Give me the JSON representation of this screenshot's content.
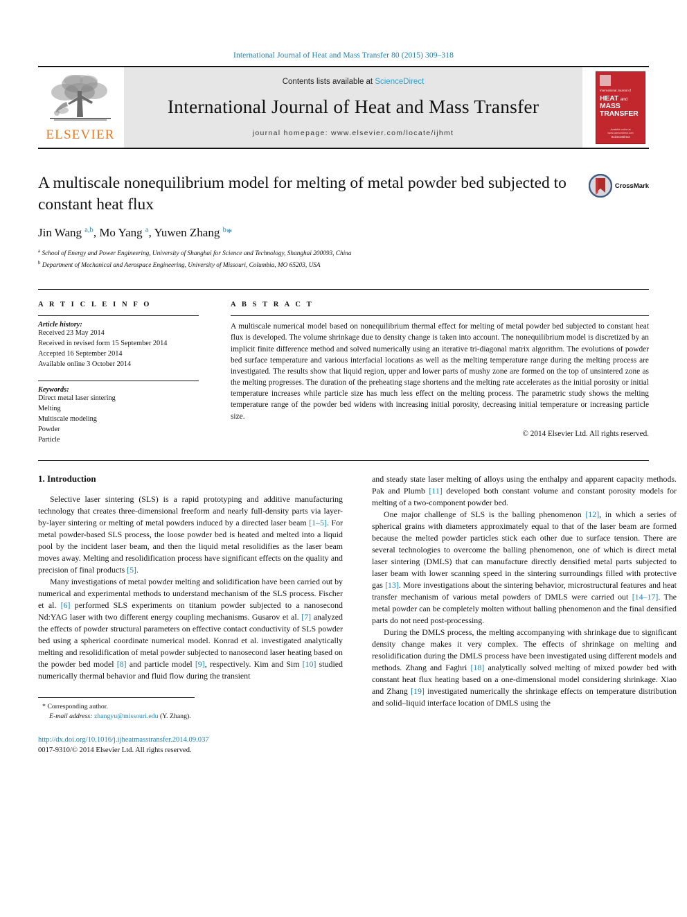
{
  "running_head": "International Journal of Heat and Mass Transfer 80 (2015) 309–318",
  "masthead": {
    "publisher_name": "ELSEVIER",
    "contents_prefix": "Contents lists available at ",
    "contents_link": "ScienceDirect",
    "journal_title": "International Journal of Heat and Mass Transfer",
    "homepage": "journal homepage: www.elsevier.com/locate/ijhmt",
    "cover": {
      "small_line": "International Journal of",
      "big_line_1": "HEAT",
      "big_and": "and",
      "big_line_2": "MASS",
      "big_line_3": "TRANSFER",
      "foot_small": "Available online at www.sciencedirect.com",
      "foot_brand": "ScienceDirect"
    }
  },
  "article": {
    "title": "A multiscale nonequilibrium model for melting of metal powder bed subjected to constant heat flux",
    "authors_html": "Jin Wang <sup>a,b</sup>, Mo Yang <sup>a</sup>, Yuwen Zhang <sup>b</sup><span class=\"star\">*</span>",
    "affiliation_a": "School of Energy and Power Engineering, University of Shanghai for Science and Technology, Shanghai 200093, China",
    "affiliation_b": "Department of Mechanical and Aerospace Engineering, University of Missouri, Columbia, MO 65203, USA",
    "crossmark_label": "CrossMark"
  },
  "info": {
    "heading": "A R T I C L E    I N F O",
    "history_label": "Article history:",
    "history": [
      "Received 23 May 2014",
      "Received in revised form 15 September 2014",
      "Accepted 16 September 2014",
      "Available online 3 October 2014"
    ],
    "keywords_label": "Keywords:",
    "keywords": [
      "Direct metal laser sintering",
      "Melting",
      "Multiscale modeling",
      "Powder",
      "Particle"
    ]
  },
  "abstract": {
    "heading": "A B S T R A C T",
    "text": "A multiscale numerical model based on nonequilibrium thermal effect for melting of metal powder bed subjected to constant heat flux is developed. The volume shrinkage due to density change is taken into account. The nonequilibrium model is discretized by an implicit finite difference method and solved numerically using an iterative tri-diagonal matrix algorithm. The evolutions of powder bed surface temperature and various interfacial locations as well as the melting temperature range during the melting process are investigated. The results show that liquid region, upper and lower parts of mushy zone are formed on the top of unsintered zone as the melting progresses. The duration of the preheating stage shortens and the melting rate accelerates as the initial porosity or initial temperature increases while particle size has much less effect on the melting process. The parametric study shows the melting temperature range of the powder bed widens with increasing initial porosity, decreasing initial temperature or increasing particle size.",
    "copyright": "© 2014 Elsevier Ltd. All rights reserved."
  },
  "body": {
    "section_title": "1. Introduction",
    "left_paragraphs": [
      "Selective laser sintering (SLS) is a rapid prototyping and additive manufacturing technology that creates three-dimensional freeform and nearly full-density parts via layer-by-layer sintering or melting of metal powders induced by a directed laser beam [1–5]. For metal powder-based SLS process, the loose powder bed is heated and melted into a liquid pool by the incident laser beam, and then the liquid metal resolidifies as the laser beam moves away. Melting and resolidification process have significant effects on the quality and precision of final products [5].",
      "Many investigations of metal powder melting and solidification have been carried out by numerical and experimental methods to understand mechanism of the SLS process. Fischer et al. [6] performed SLS experiments on titanium powder subjected to a nanosecond Nd:YAG laser with two different energy coupling mechanisms. Gusarov et al. [7] analyzed the effects of powder structural parameters on effective contact conductivity of SLS powder bed using a spherical coordinate numerical model. Konrad et al. investigated analytically melting and resolidification of metal powder subjected to nanosecond laser heating based on the powder bed model [8] and particle model [9], respectively. Kim and Sim [10] studied numerically thermal behavior and fluid flow during the transient"
    ],
    "right_paragraphs": [
      "and steady state laser melting of alloys using the enthalpy and apparent capacity methods. Pak and Plumb [11] developed both constant volume and constant porosity models for melting of a two-component powder bed.",
      "One major challenge of SLS is the balling phenomenon [12], in which a series of spherical grains with diameters approximately equal to that of the laser beam are formed because the melted powder particles stick each other due to surface tension. There are several technologies to overcome the balling phenomenon, one of which is direct metal laser sintering (DMLS) that can manufacture directly densified metal parts subjected to laser beam with lower scanning speed in the sintering surroundings filled with protective gas [13]. More investigations about the sintering behavior, microstructural features and heat transfer mechanism of various metal powders of DMLS were carried out [14–17]. The metal powder can be completely molten without balling phenomenon and the final densified parts do not need post-processing.",
      "During the DMLS process, the melting accompanying with shrinkage due to significant density change makes it very complex. The effects of shrinkage on melting and resolidification during the DMLS process have been investigated using different models and methods. Zhang and Faghri [18] analytically solved melting of mixed powder bed with constant heat flux heating based on a one-dimensional model considering shrinkage. Xiao and Zhang [19] investigated numerically the shrinkage effects on temperature distribution and solid–liquid interface location of DMLS using the"
    ]
  },
  "footnote": {
    "corresponding_mark": "*",
    "corresponding_text": "Corresponding author.",
    "email_label": "E-mail address:",
    "email": "zhangyu@missouri.edu",
    "email_suffix": "(Y. Zhang)."
  },
  "publisher_footer": {
    "doi": "http://dx.doi.org/10.1016/j.ijheatmasstransfer.2014.09.037",
    "issn_line": "0017-9310/© 2014 Elsevier Ltd. All rights reserved."
  },
  "colors": {
    "link_blue": "#1a7fb5",
    "elsevier_orange": "#E87722",
    "cover_red": "#c1272d",
    "band_grey": "#e6e6e6"
  }
}
